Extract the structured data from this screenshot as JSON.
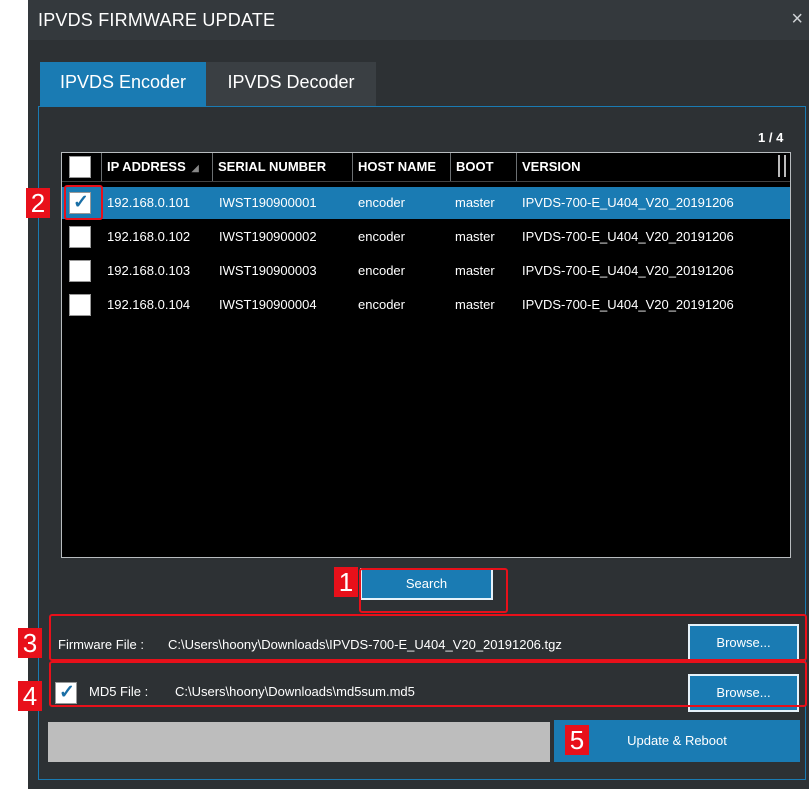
{
  "window": {
    "title": "IPVDS FIRMWARE UPDATE",
    "close_glyph": "×"
  },
  "tabs": [
    {
      "label": "IPVDS Encoder",
      "active": true
    },
    {
      "label": "IPVDS Decoder",
      "active": false
    }
  ],
  "pager": "1 / 4",
  "table": {
    "columns": [
      "IP ADDRESS",
      "SERIAL NUMBER",
      "HOST NAME",
      "BOOT",
      "VERSION"
    ],
    "sort_indicator": "◢",
    "rows": [
      {
        "checked": true,
        "ip": "192.168.0.101",
        "serial": "IWST190900001",
        "host": "encoder",
        "boot": "master",
        "version": "IPVDS-700-E_U404_V20_20191206"
      },
      {
        "checked": false,
        "ip": "192.168.0.102",
        "serial": "IWST190900002",
        "host": "encoder",
        "boot": "master",
        "version": "IPVDS-700-E_U404_V20_20191206"
      },
      {
        "checked": false,
        "ip": "192.168.0.103",
        "serial": "IWST190900003",
        "host": "encoder",
        "boot": "master",
        "version": "IPVDS-700-E_U404_V20_20191206"
      },
      {
        "checked": false,
        "ip": "192.168.0.104",
        "serial": "IWST190900004",
        "host": "encoder",
        "boot": "master",
        "version": "IPVDS-700-E_U404_V20_20191206"
      }
    ]
  },
  "search_button": "Search",
  "firmware": {
    "label": "Firmware File :",
    "path": "C:\\Users\\hoony\\Downloads\\IPVDS-700-E_U404_V20_20191206.tgz",
    "browse": "Browse..."
  },
  "md5": {
    "checked": true,
    "label": "MD5 File :",
    "path": "C:\\Users\\hoony\\Downloads\\md5sum.md5",
    "browse": "Browse..."
  },
  "update_button": "Update & Reboot",
  "annotations": [
    "1",
    "2",
    "3",
    "4",
    "5"
  ],
  "colors": {
    "accent": "#1a7bb3",
    "background": "#2d3134",
    "annotation_red": "#e8101a"
  }
}
